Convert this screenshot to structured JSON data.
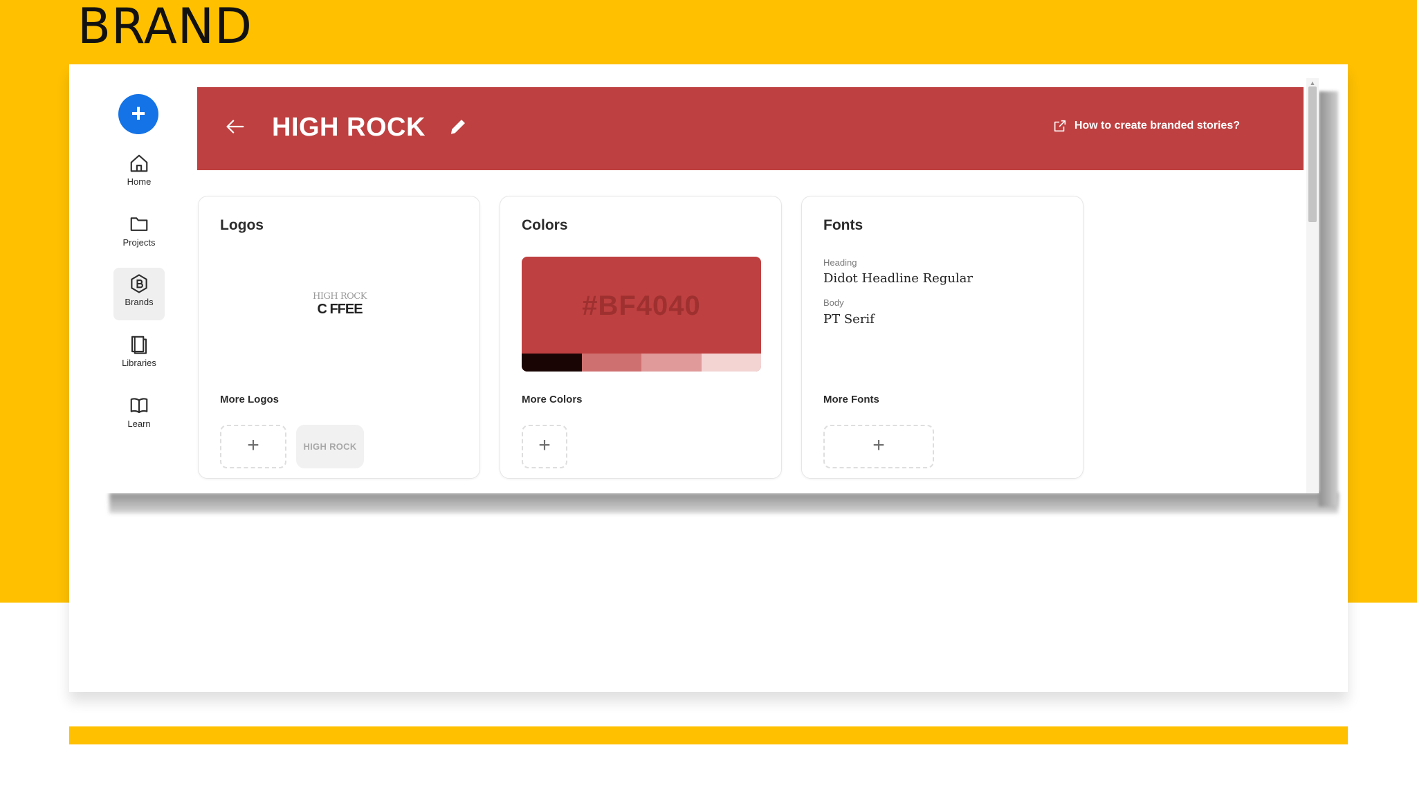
{
  "slide": {
    "title": "BRAND"
  },
  "rail": {
    "fab_icon": "plus-icon",
    "items": [
      {
        "label": "Home",
        "icon": "home-icon"
      },
      {
        "label": "Projects",
        "icon": "folder-icon"
      },
      {
        "label": "Brands",
        "icon": "brand-badge-icon"
      },
      {
        "label": "Libraries",
        "icon": "library-icon"
      },
      {
        "label": "Learn",
        "icon": "book-icon"
      }
    ],
    "active": "Brands"
  },
  "header": {
    "brand_name": "HIGH ROCK",
    "help_link": "How to create branded stories?",
    "color": "#BF4040"
  },
  "logos": {
    "title": "Logos",
    "logo_top": "HIGH ROCK",
    "logo_bottom": "C FFEE",
    "more_label": "More Logos",
    "add_icon": "+",
    "chip_label": "HIGH ROCK"
  },
  "colors": {
    "title": "Colors",
    "primary_hex": "#BF4040",
    "tints": [
      "#1a0505",
      "#cf7070",
      "#e09a9a",
      "#f4d3d3"
    ],
    "more_label": "More Colors",
    "add_icon": "+"
  },
  "fonts": {
    "title": "Fonts",
    "heading_label": "Heading",
    "heading_font": "Didot Headline Regular",
    "body_label": "Body",
    "body_font": "PT Serif",
    "more_label": "More Fonts",
    "add_icon": "+"
  },
  "theme": {
    "slide_yellow": "#FFC000",
    "fab_blue": "#1473E6"
  }
}
